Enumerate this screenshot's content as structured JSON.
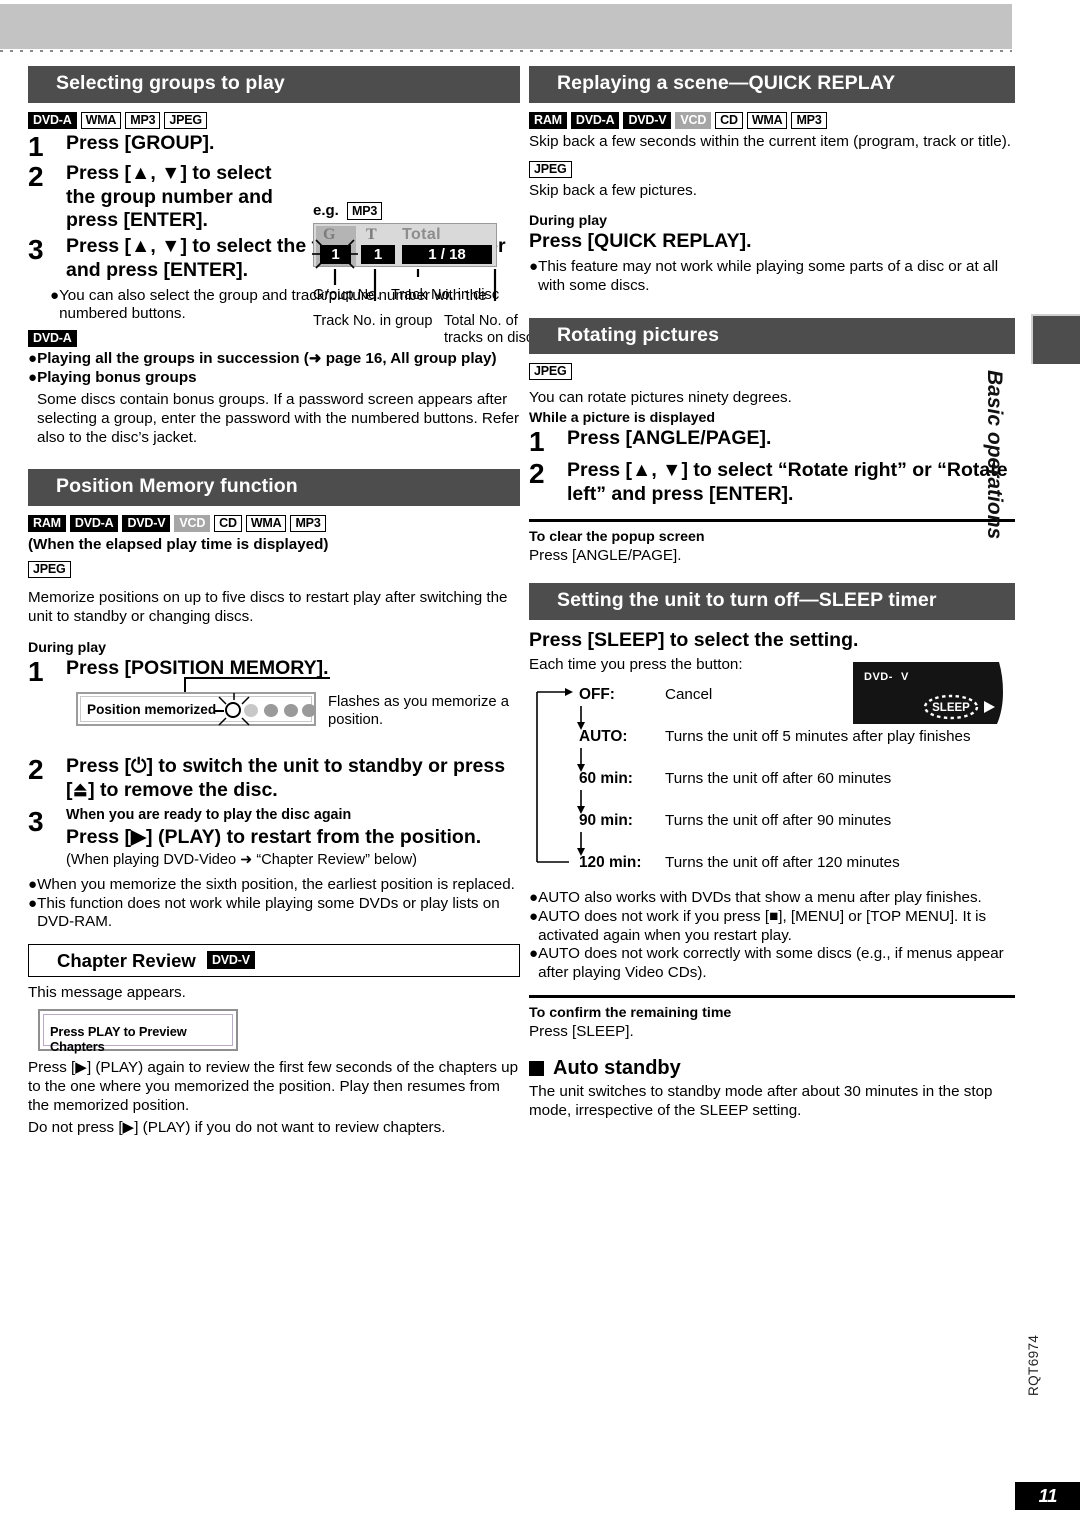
{
  "page": {
    "number": "11",
    "doc_code": "RQT6974",
    "side_tab_label": "Basic operations"
  },
  "left": {
    "section1": {
      "title": "Selecting groups to play",
      "badges": [
        {
          "label": "DVD-A",
          "style": "dark"
        },
        {
          "label": "WMA",
          "style": "light"
        },
        {
          "label": "MP3",
          "style": "light"
        },
        {
          "label": "JPEG",
          "style": "light"
        }
      ],
      "steps": [
        {
          "num": "1",
          "text": "Press [GROUP]."
        },
        {
          "num": "2",
          "text": "Press [▲, ▼] to select the group number and press [ENTER]."
        },
        {
          "num": "3",
          "text": "Press [▲, ▼] to select the track/picture number and press [ENTER]."
        }
      ],
      "note_bullet": "You can also select the group and track/picture number with the numbered buttons.",
      "dvda_badge": "DVD-A",
      "bullets": [
        "Playing all the groups in succession (➜ page 16, All group play)",
        "Playing bonus groups"
      ],
      "bonus_text": "Some discs contain bonus groups. If a password screen appears after selecting a group, enter the password with the numbered buttons. Refer also to the disc’s jacket.",
      "example": {
        "eg_label": "e.g.",
        "eg_badge": "MP3",
        "display": {
          "icon_group": "G",
          "icon_track": "T",
          "total_word": "Total",
          "group_no": "1",
          "track_no": "1",
          "total": "1 / 18"
        },
        "callouts": {
          "group_no": "Group No.",
          "track_in_disc": "Track No. in disc",
          "track_in_group": "Track No. in group",
          "total_tracks": "Total No. of tracks on disc"
        }
      }
    },
    "section2": {
      "title": "Position Memory function",
      "badges": [
        {
          "label": "RAM",
          "style": "dark"
        },
        {
          "label": "DVD-A",
          "style": "dark"
        },
        {
          "label": "DVD-V",
          "style": "dark"
        },
        {
          "label": "VCD",
          "style": "gray"
        },
        {
          "label": "CD",
          "style": "light"
        },
        {
          "label": "WMA",
          "style": "light"
        },
        {
          "label": "MP3",
          "style": "light"
        }
      ],
      "condition": "(When the elapsed play time is displayed)",
      "jpeg_badge": "JPEG",
      "intro": "Memorize positions on up to five discs to restart play after switching the unit to standby or changing discs.",
      "during_play": "During play",
      "steps": [
        {
          "num": "1",
          "text": "Press [POSITION MEMORY]."
        },
        {
          "num": "2",
          "text": "Press [⏻] to switch the unit to standby or press [⏏] to remove the disc."
        },
        {
          "num": "3",
          "heading": "When you are ready to play the disc again",
          "text": "Press [▶] (PLAY) to restart from the position.",
          "sub": "(When playing DVD-Video ➜ “Chapter Review” below)"
        }
      ],
      "illus": {
        "label": "Position memorized",
        "note": "Flashes as you memorize a position."
      },
      "bullets": [
        "When you memorize the sixth position, the earliest position is replaced.",
        "This function does not work while playing some DVDs or play lists on DVD-RAM."
      ]
    },
    "section3": {
      "title": "Chapter Review",
      "title_badge": "DVD-V",
      "lead": "This message appears.",
      "message_box": "Press PLAY to Preview Chapters",
      "para1": "Press [▶] (PLAY) again to review the first few seconds of the chapters up to the one where you memorized the position. Play then resumes from the memorized position.",
      "para2": "Do not press [▶] (PLAY) if you do not want to review chapters."
    }
  },
  "right": {
    "section1": {
      "title": "Replaying a scene—QUICK REPLAY",
      "badges": [
        {
          "label": "RAM",
          "style": "dark"
        },
        {
          "label": "DVD-A",
          "style": "dark"
        },
        {
          "label": "DVD-V",
          "style": "dark"
        },
        {
          "label": "VCD",
          "style": "gray"
        },
        {
          "label": "CD",
          "style": "light"
        },
        {
          "label": "WMA",
          "style": "light"
        },
        {
          "label": "MP3",
          "style": "light"
        }
      ],
      "text1": "Skip back a few seconds within the current item (program, track or title).",
      "jpeg_badge": "JPEG",
      "text2": "Skip back a few pictures.",
      "during_play": "During play",
      "action": "Press [QUICK REPLAY].",
      "bullet": "This feature may not work while playing some parts of a disc or at all with some discs."
    },
    "section2": {
      "title": "Rotating pictures",
      "jpeg_badge": "JPEG",
      "text": "You can rotate pictures ninety degrees.",
      "condition": "While a picture is displayed",
      "steps": [
        {
          "num": "1",
          "text": "Press [ANGLE/PAGE]."
        },
        {
          "num": "2",
          "text": "Press [▲, ▼] to select “Rotate right” or “Rotate left” and press [ENTER]."
        }
      ],
      "clear_heading": "To clear the popup screen",
      "clear_text": "Press [ANGLE/PAGE]."
    },
    "section3": {
      "title": "Setting the unit to turn off—SLEEP timer",
      "action": "Press [SLEEP] to select the setting.",
      "lead": "Each time you press the button:",
      "flow": [
        {
          "key": "OFF:",
          "value": "Cancel"
        },
        {
          "key": "AUTO:",
          "value": "Turns the unit off 5 minutes after play finishes"
        },
        {
          "key": "60 min:",
          "value": "Turns the unit off after 60 minutes"
        },
        {
          "key": "90 min:",
          "value": "Turns the unit off after 90 minutes"
        },
        {
          "key": "120 min:",
          "value": "Turns the unit off after 120 minutes"
        }
      ],
      "display": {
        "label": "DVD- V",
        "indicator": "SLEEP"
      },
      "bullets": [
        "AUTO also works with DVDs that show a menu after play finishes.",
        "AUTO does not work if you press [■], [MENU] or [TOP MENU]. It is activated again when you restart play.",
        "AUTO does not work correctly with some discs (e.g., if menus appear after playing Video CDs)."
      ],
      "confirm_heading": "To confirm the remaining time",
      "confirm_text": "Press [SLEEP].",
      "auto_standby_heading": "Auto standby",
      "auto_standby_text": "The unit switches to standby mode after about 30 minutes in the stop mode, irrespective of the SLEEP setting."
    }
  }
}
